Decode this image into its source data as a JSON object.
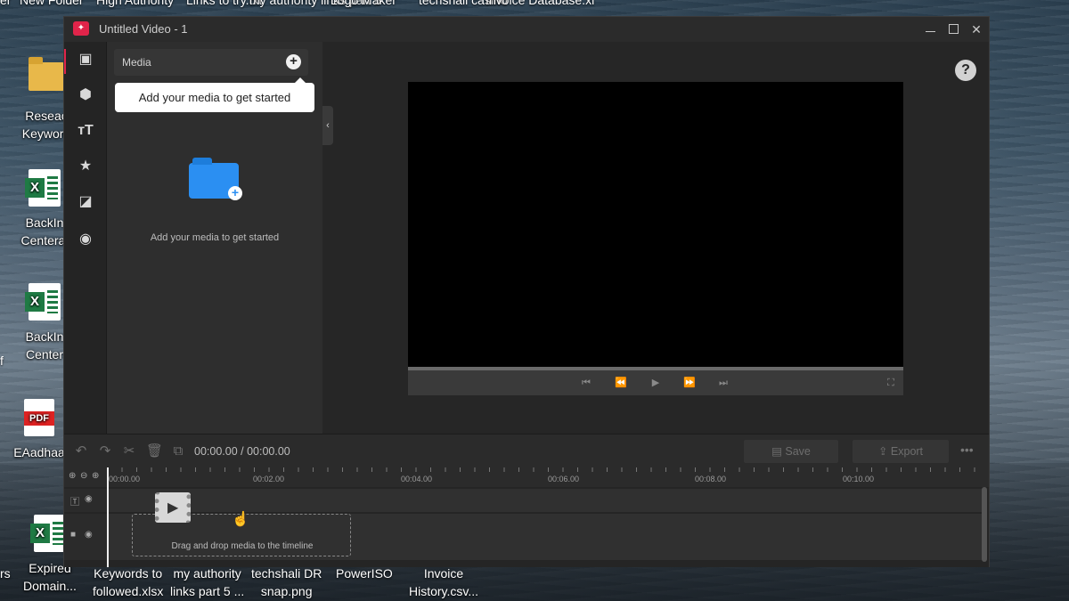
{
  "desktop": {
    "top_labels": [
      "er",
      "New Folder",
      "High Authority",
      "Links to try.txt",
      "my authority links part 5",
      "Logo Maker",
      "techshali casino",
      "Invoice Database.xl"
    ],
    "icons": [
      {
        "label1": "Reseac",
        "label2": "Keyword"
      },
      {
        "label1": "BackIn",
        "label2": "Centeral"
      },
      {
        "label1": "BackIn",
        "label2": "Center"
      },
      {
        "label1": "EAadhaa",
        "label2": ""
      },
      {
        "label1": "Expired",
        "label2": "Domain..."
      }
    ],
    "left_edge": [
      "f",
      "rs"
    ],
    "bottom_labels": [
      {
        "l1": "Keywords to",
        "l2": "followed.xlsx"
      },
      {
        "l1": "my authority",
        "l2": "links part 5 ..."
      },
      {
        "l1": "techshali DR",
        "l2": "snap.png"
      },
      {
        "l1": "PowerISO",
        "l2": ""
      },
      {
        "l1": "Invoice",
        "l2": "History.csv..."
      }
    ],
    "pdf_badge": "PDF"
  },
  "window": {
    "title": "Untitled Video - 1",
    "minimize": "",
    "maximize": "",
    "close": "✕"
  },
  "sidebar": {
    "tools": [
      "media-icon",
      "sticker-icon",
      "text-icon",
      "effects-icon",
      "transitions-icon",
      "filters-icon"
    ]
  },
  "media": {
    "title": "Media",
    "add": "+",
    "tooltip": "Add your media to get started",
    "empty_text": "Add your media to get started",
    "collapse": "‹"
  },
  "preview": {
    "help": "?"
  },
  "timeline": {
    "timecode": "00:00.00 / 00:00.00",
    "save_label": "Save",
    "export_label": "Export",
    "more": "•••",
    "ticks": [
      "00:00.00",
      "00:02.00",
      "00:04.00",
      "00:06.00",
      "00:08.00",
      "00:10.00"
    ],
    "drop_text": "Drag and drop media to the timeline"
  }
}
